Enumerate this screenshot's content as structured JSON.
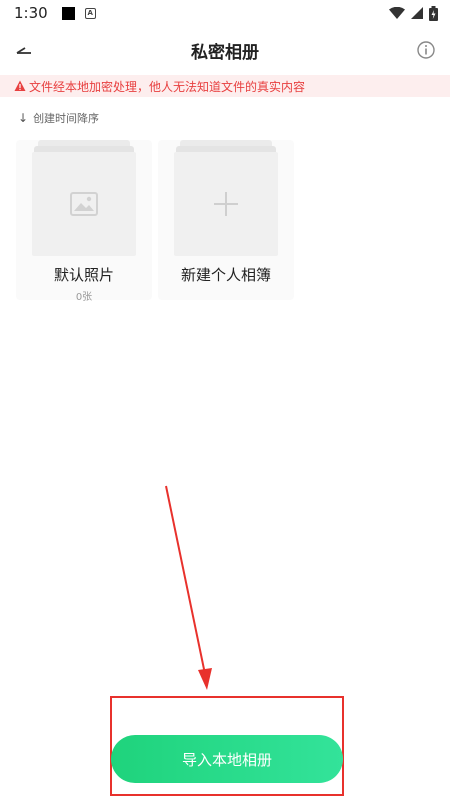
{
  "status_bar": {
    "time": "1:30"
  },
  "header": {
    "title": "私密相册"
  },
  "notice": {
    "text": "文件经本地加密处理，他人无法知道文件的真实内容"
  },
  "sort": {
    "label": "创建时间降序"
  },
  "albums": [
    {
      "name": "默认照片",
      "count": "0张",
      "cover_icon": "image-icon"
    },
    {
      "name": "新建个人相簿",
      "count": "",
      "cover_icon": "plus-icon"
    }
  ],
  "actions": {
    "import_label": "导入本地相册"
  },
  "colors": {
    "accent_green": "#25d986",
    "warning_red": "#e84040",
    "warning_bg": "#fdeeee",
    "annotation_red": "#e8312c"
  }
}
